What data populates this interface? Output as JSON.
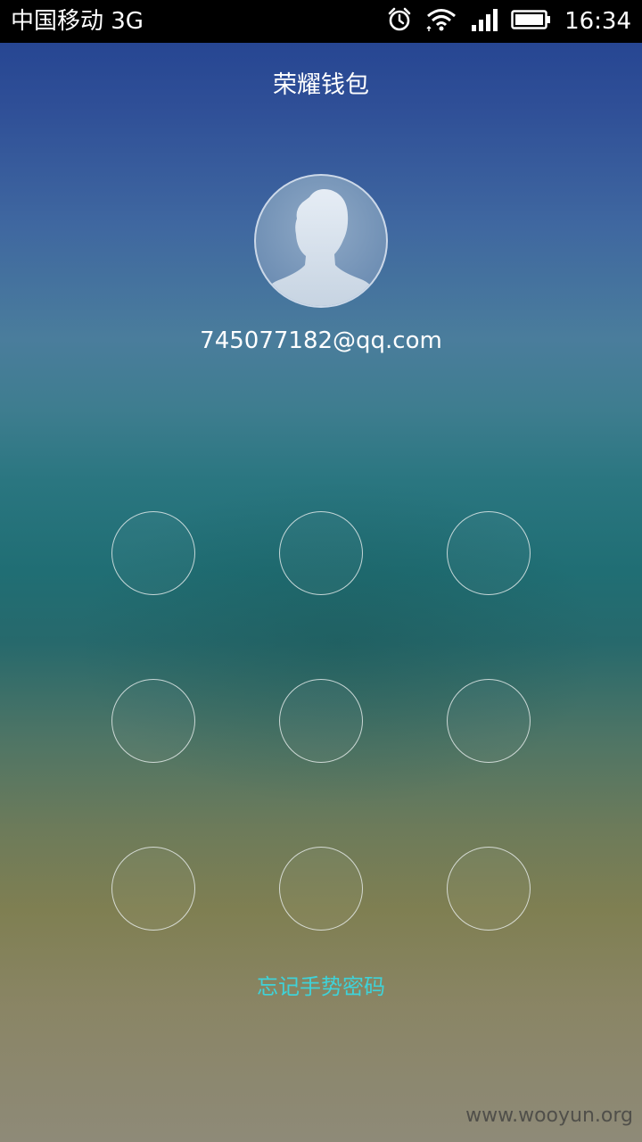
{
  "status_bar": {
    "carrier": "中国移动 3G",
    "time": "16:34",
    "icons": [
      "alarm-icon",
      "wifi-icon",
      "signal-icon",
      "battery-icon"
    ]
  },
  "app": {
    "title": "荣耀钱包"
  },
  "account": {
    "avatar": "default-user-avatar",
    "username": "745077182@qq.com"
  },
  "gesture_pad": {
    "rows": 3,
    "cols": 3,
    "nodes": [
      1,
      2,
      3,
      4,
      5,
      6,
      7,
      8,
      9
    ]
  },
  "forgot_link": "忘记手势密码",
  "watermark": "www.wooyun.org",
  "colors": {
    "accent_link": "#3fd2d8",
    "status_bar_bg": "#000000",
    "text_primary": "#ffffff"
  }
}
